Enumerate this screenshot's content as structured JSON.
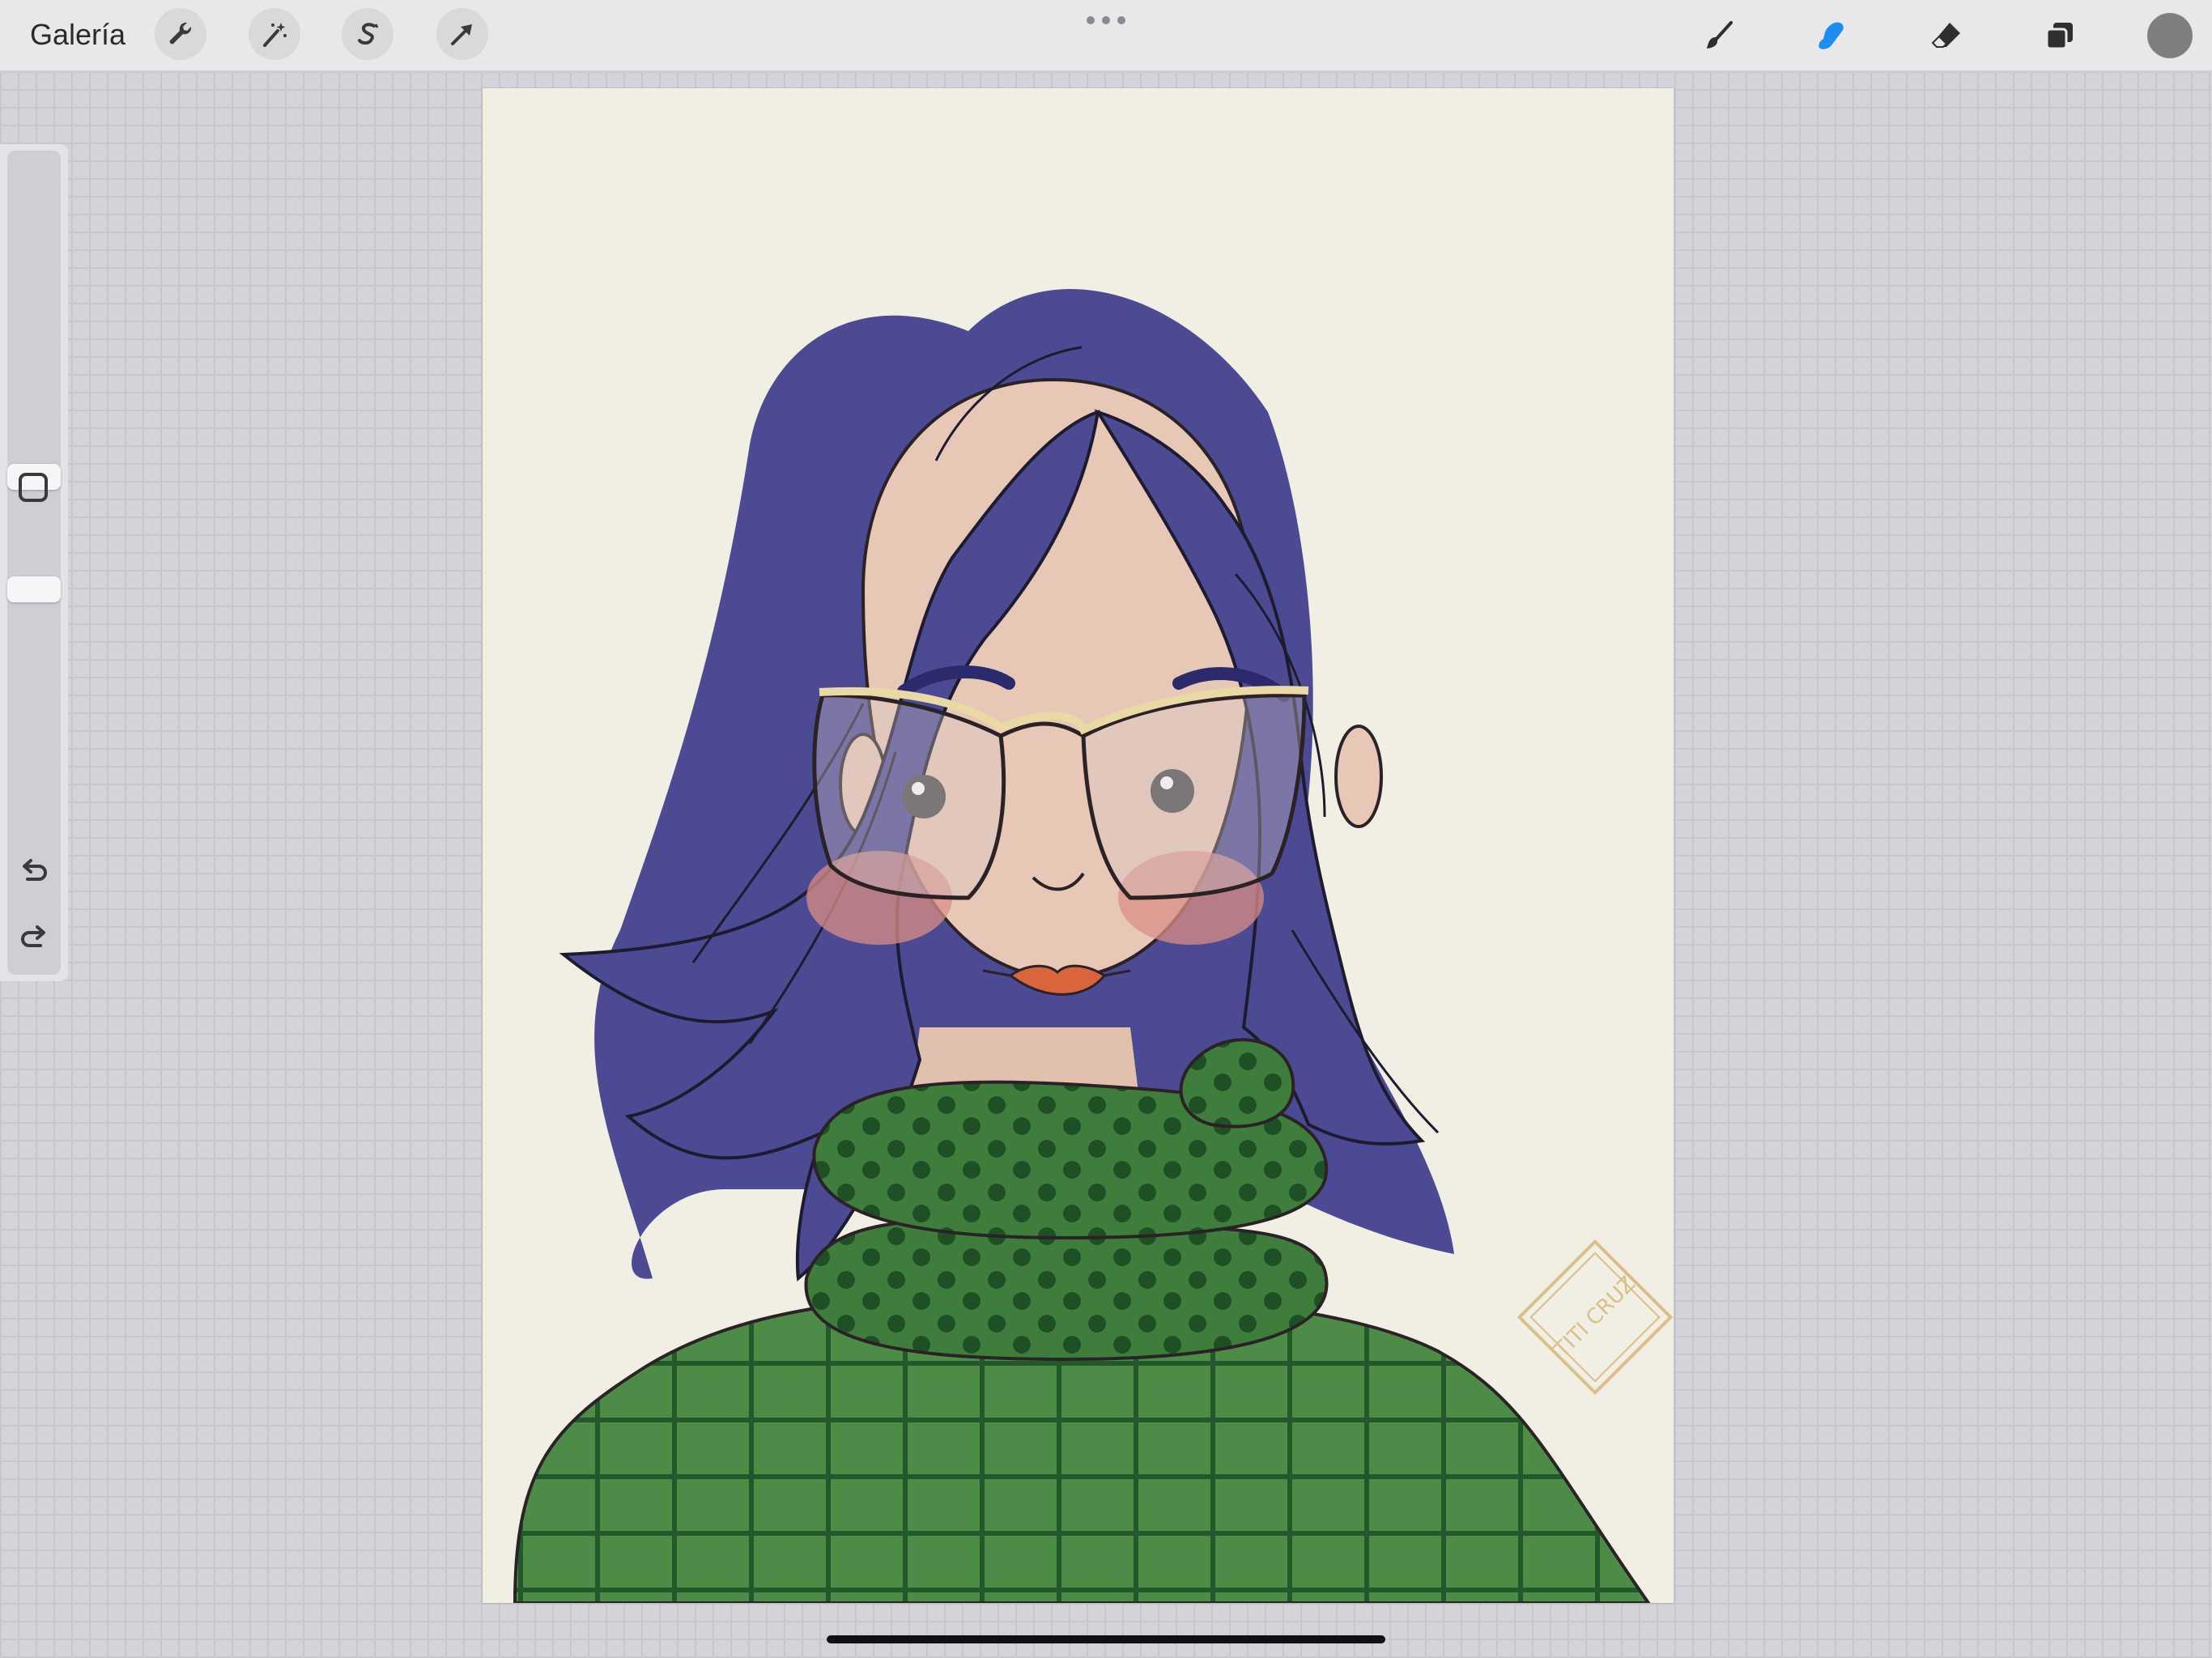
{
  "topbar": {
    "gallery_label": "Galería",
    "left_tools": [
      {
        "name": "actions",
        "icon": "wrench-icon"
      },
      {
        "name": "adjustments",
        "icon": "magic-wand-icon"
      },
      {
        "name": "selection",
        "icon": "selection-s-icon"
      },
      {
        "name": "transform",
        "icon": "arrow-cursor-icon"
      }
    ],
    "more_icon": "more-dots-icon",
    "right_tools": [
      {
        "name": "paint",
        "icon": "brush-icon",
        "active": false
      },
      {
        "name": "smudge",
        "icon": "smudge-finger-icon",
        "active": true
      },
      {
        "name": "erase",
        "icon": "eraser-icon",
        "active": false
      },
      {
        "name": "layers",
        "icon": "layers-icon",
        "active": false
      }
    ],
    "current_color": "#7f7f82",
    "active_tool_color": "#1f8cf0"
  },
  "sidebar": {
    "brush_size_level": 0.2,
    "opacity_level": 0.95,
    "modify_icon": "square-outline-icon",
    "undo_icon": "undo-icon",
    "redo_icon": "redo-icon"
  },
  "canvas": {
    "artwork": "watercolor portrait illustration",
    "signature_text": "TITI CRUZ",
    "colors": {
      "paper": "#f1eee3",
      "hair": "#4b4a92",
      "skin": "#e7c7b6",
      "sweater": "#4a8a45",
      "scarf": "#3f7d3c",
      "lips": "#d9653c"
    }
  }
}
